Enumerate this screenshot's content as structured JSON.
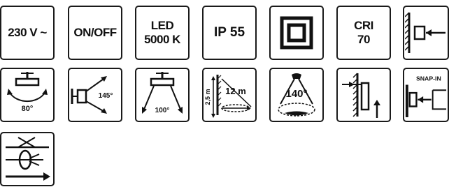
{
  "icons": {
    "voltage": {
      "label": "230 V ~",
      "icon": "voltage-label"
    },
    "switch": {
      "label": "ON/OFF",
      "icon": "on-off-label"
    },
    "led": {
      "line1": "LED",
      "line2": "5000 K",
      "icon": "led-color-temperature-label"
    },
    "ip": {
      "label": "IP 55",
      "icon": "ip-rating-label"
    },
    "protection_class": {
      "icon": "double-insulation-class-ii-icon"
    },
    "cri": {
      "line1": "CRI",
      "line2": "70",
      "icon": "cri-label"
    },
    "wall_mount": {
      "icon": "wall-mount-icon"
    },
    "tilt_angle": {
      "angle": "80°",
      "icon": "tilt-rotation-icon"
    },
    "swivel_angle": {
      "angle": "145°",
      "icon": "swivel-angle-icon"
    },
    "beam_angle_side": {
      "angle": "100°",
      "icon": "beam-angle-icon"
    },
    "detection_range": {
      "height": "2,5 m",
      "range": "12 m",
      "icon": "detection-range-icon"
    },
    "detection_angle": {
      "angle": "140°",
      "icon": "detection-angle-icon"
    },
    "mounting_height": {
      "icon": "mounting-height-icon"
    },
    "snap_in": {
      "label": "SNAP-IN",
      "icon": "snap-in-mount-icon"
    },
    "cable_entry": {
      "icon": "cable-entry-icon"
    }
  }
}
